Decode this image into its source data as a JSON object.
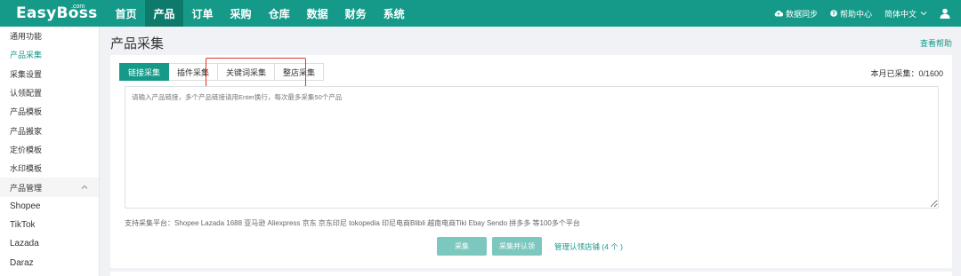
{
  "logo": {
    "text": "EasyBoss",
    "suffix": ".com"
  },
  "nav": {
    "items": [
      {
        "label": "首页"
      },
      {
        "label": "产品"
      },
      {
        "label": "订单"
      },
      {
        "label": "采购"
      },
      {
        "label": "仓库"
      },
      {
        "label": "数据"
      },
      {
        "label": "财务"
      },
      {
        "label": "系统"
      }
    ],
    "active_index": 1
  },
  "top_right": {
    "sync": "数据同步",
    "help": "帮助中心",
    "language": "简体中文"
  },
  "sidebar": {
    "items": [
      {
        "label": "通用功能"
      },
      {
        "label": "产品采集"
      },
      {
        "label": "采集设置"
      },
      {
        "label": "认领配置"
      },
      {
        "label": "产品模板"
      },
      {
        "label": "产品搬家"
      },
      {
        "label": "定价模板"
      },
      {
        "label": "水印模板"
      }
    ],
    "group": {
      "label": "产品管理"
    },
    "platforms": [
      {
        "label": "Shopee"
      },
      {
        "label": "TikTok"
      },
      {
        "label": "Lazada"
      },
      {
        "label": "Daraz"
      }
    ]
  },
  "page": {
    "title": "产品采集",
    "help_link": "查看帮助"
  },
  "tabs": [
    {
      "label": "链接采集"
    },
    {
      "label": "插件采集"
    },
    {
      "label": "关键词采集"
    },
    {
      "label": "整店采集"
    }
  ],
  "count": "本月已采集：0/1600",
  "input": {
    "placeholder": "请输入产品链接，多个产品链接请用Enter换行，每次最多采集50个产品",
    "value": ""
  },
  "platforms_text": "支持采集平台：Shopee   Lazada   1688   亚马逊   Aliexpress   京东   京东印尼   tokopedia   印尼电商Blibli   越南电商Tiki   Ebay   Sendo   拼多多 等100多个平台",
  "buttons": {
    "collect": "采集",
    "collect_claim": "采集并认领",
    "manage": "管理认领店铺 (4 个 )"
  },
  "colors": {
    "primary": "#159a8a",
    "primary_dark": "#0e7a6c",
    "button_disabled": "#7cc8be",
    "highlight": "#e5332a"
  }
}
